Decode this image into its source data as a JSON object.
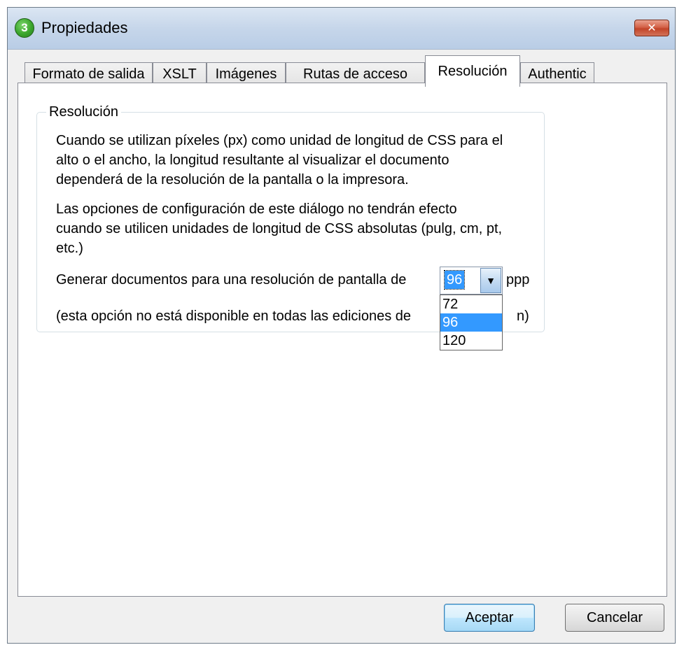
{
  "window": {
    "title": "Propiedades",
    "app_icon_glyph": "3",
    "close_glyph": "✕"
  },
  "tabs": [
    {
      "label": "Formato de salida",
      "active": false
    },
    {
      "label": "XSLT",
      "active": false
    },
    {
      "label": "Imágenes",
      "active": false
    },
    {
      "label": "Rutas de acceso",
      "active": false
    },
    {
      "label": "Resolución",
      "active": true
    },
    {
      "label": "Authentic",
      "active": false
    }
  ],
  "group": {
    "legend": "Resolución",
    "para1": [
      "Cuando se utilizan píxeles (px) como unidad de longitud de CSS para el",
      "alto o el ancho, la longitud resultante al visualizar el documento",
      "dependerá de la resolución de la pantalla o la impresora."
    ],
    "para2": [
      "Las opciones de configuración de este diálogo no tendrán efecto",
      "cuando se utilicen unidades de longitud de CSS absolutas (pulg, cm, pt,",
      "etc.)"
    ],
    "resolution_label": "Generar documentos para una resolución de pantalla de",
    "resolution_value": "96",
    "resolution_unit": "ppp",
    "dropdown_options": [
      "72",
      "96",
      "120"
    ],
    "dropdown_selected": "96",
    "note": "(esta opción no está disponible en todas las ediciones de",
    "note_tail": "n)"
  },
  "buttons": {
    "ok": "Aceptar",
    "cancel": "Cancelar"
  },
  "colors": {
    "selection": "#3399ff",
    "close_button": "#c24428"
  },
  "icons": {
    "app": "altova-logo-icon",
    "close": "close-icon",
    "dropdown": "chevron-down-icon"
  }
}
